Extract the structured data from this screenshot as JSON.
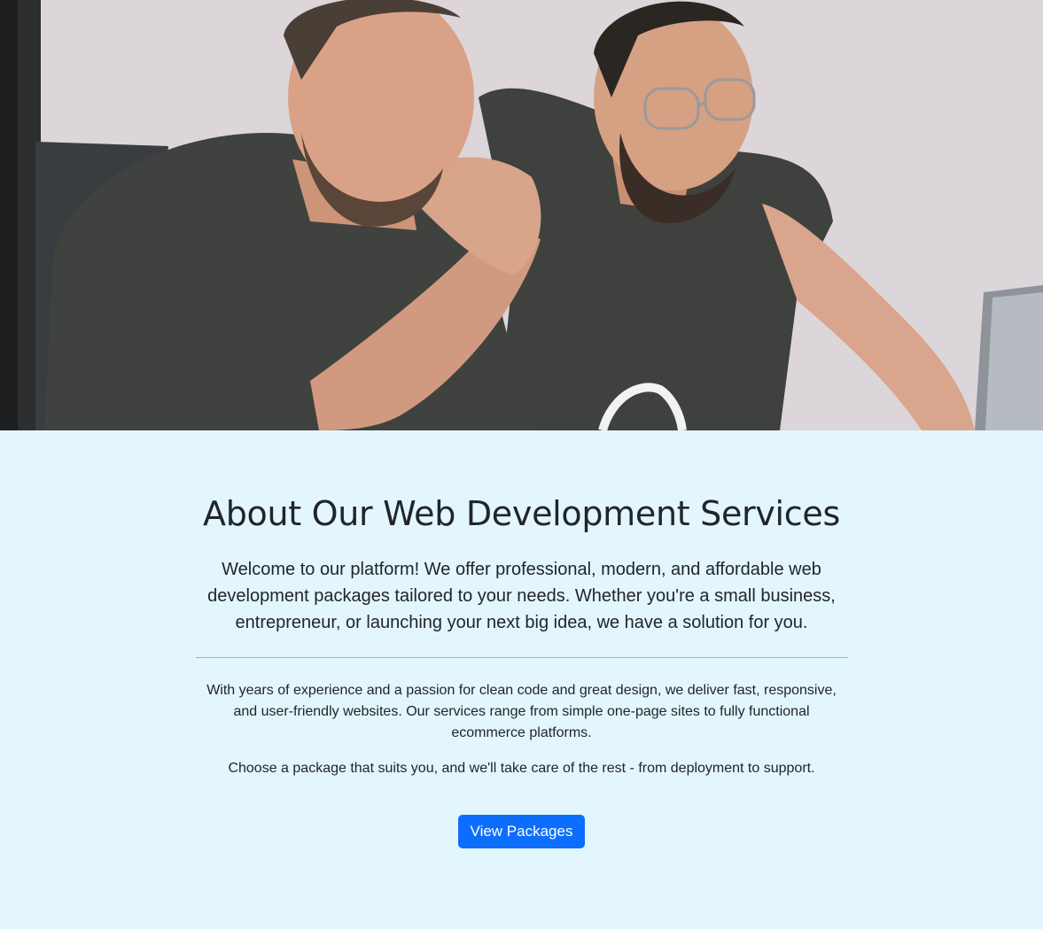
{
  "hero": {
    "image_subject": "two men smiling looking at a laptop"
  },
  "about": {
    "title": "About Our Web Development Services",
    "lead": "Welcome to our platform! We offer professional, modern, and affordable web development packages tailored to your needs. Whether you're a small business, entrepreneur, or launching your next big idea, we have a solution for you.",
    "paragraph_1": "With years of experience and a passion for clean code and great design, we deliver fast, responsive, and user-friendly websites. Our services range from simple one-page sites to fully functional ecommerce platforms.",
    "paragraph_2": "Choose a package that suits you, and we'll take care of the rest - from deployment to support.",
    "button_label": "View Packages"
  },
  "colors": {
    "section_background": "#e3f6fd",
    "button": "#0d6efd",
    "text": "#212529"
  }
}
